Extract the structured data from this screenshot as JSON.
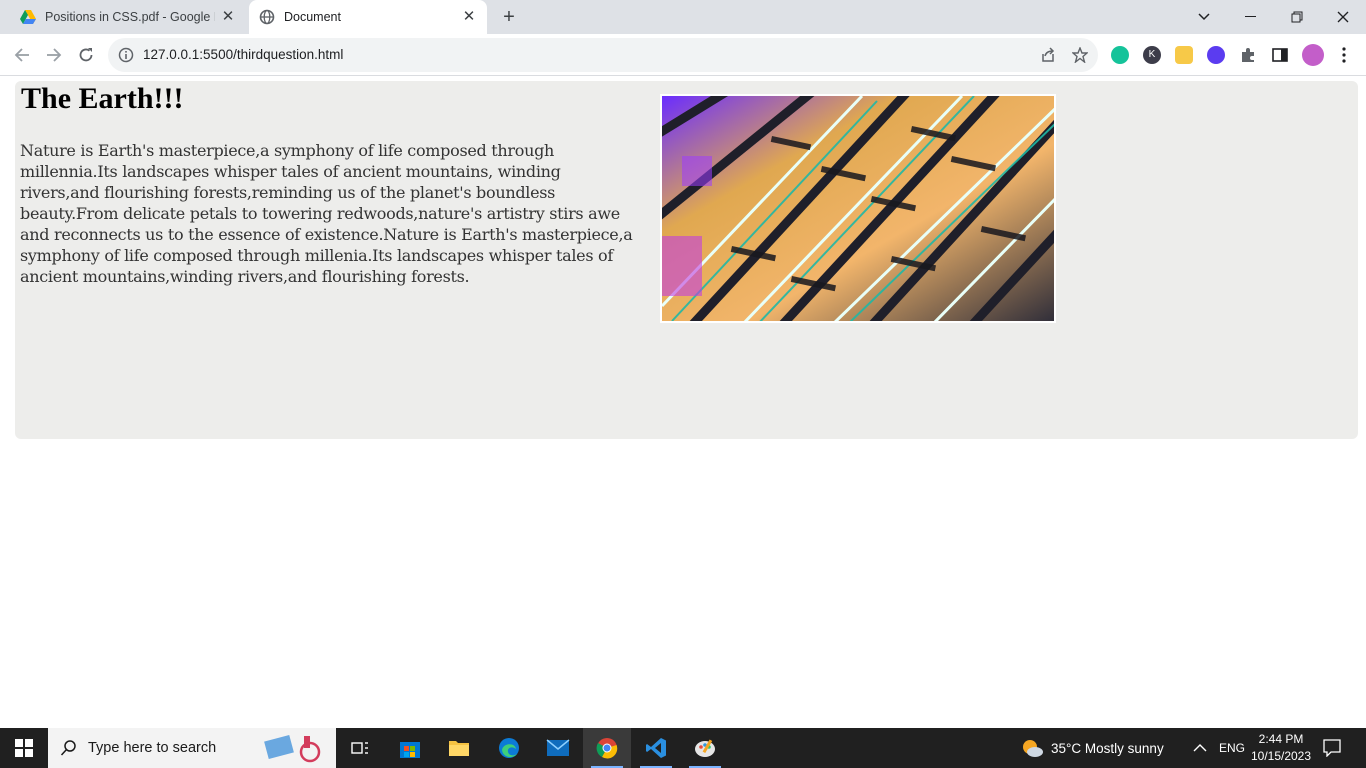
{
  "browser": {
    "tabs": [
      {
        "title": "Positions in CSS.pdf - Google Dr",
        "icon": "google-drive-icon"
      },
      {
        "title": "Document",
        "icon": "globe-icon"
      }
    ],
    "url": "127.0.0.1:5500/thirdquestion.html"
  },
  "page": {
    "heading": "The Earth!!!",
    "paragraph": "Nature is Earth's masterpiece,a symphony of life composed through millennia.Its landscapes whisper tales of ancient mountains, winding rivers,and flourishing forests,reminding us of the planet's boundless beauty.From delicate petals to towering redwoods,nature's artistry stirs awe and reconnects us to the essence of existence.Nature is Earth's masterpiece,a symphony of life composed through millenia.Its landscapes whisper tales of ancient mountains,winding rivers,and flourishing forests."
  },
  "taskbar": {
    "search_placeholder": "Type here to search",
    "weather": "35°C  Mostly sunny",
    "language": "ENG",
    "time": "2:44 PM",
    "date": "10/15/2023"
  }
}
